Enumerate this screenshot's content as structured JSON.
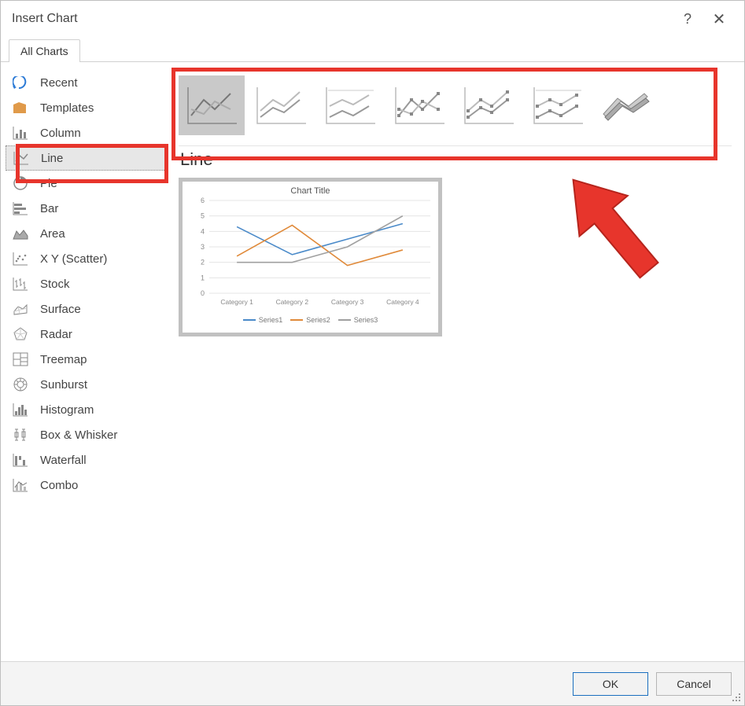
{
  "dialog": {
    "title": "Insert Chart",
    "help_glyph": "?",
    "close_glyph": "✕"
  },
  "tabs": {
    "all_charts": "All Charts"
  },
  "categories": [
    {
      "id": "recent",
      "label": "Recent",
      "icon": "recent"
    },
    {
      "id": "templates",
      "label": "Templates",
      "icon": "templates"
    },
    {
      "id": "column",
      "label": "Column",
      "icon": "column"
    },
    {
      "id": "line",
      "label": "Line",
      "icon": "line",
      "selected": true
    },
    {
      "id": "pie",
      "label": "Pie",
      "icon": "pie"
    },
    {
      "id": "bar",
      "label": "Bar",
      "icon": "bar"
    },
    {
      "id": "area",
      "label": "Area",
      "icon": "area"
    },
    {
      "id": "scatter",
      "label": "X Y (Scatter)",
      "icon": "scatter"
    },
    {
      "id": "stock",
      "label": "Stock",
      "icon": "stock"
    },
    {
      "id": "surface",
      "label": "Surface",
      "icon": "surface"
    },
    {
      "id": "radar",
      "label": "Radar",
      "icon": "radar"
    },
    {
      "id": "treemap",
      "label": "Treemap",
      "icon": "treemap"
    },
    {
      "id": "sunburst",
      "label": "Sunburst",
      "icon": "sunburst"
    },
    {
      "id": "histogram",
      "label": "Histogram",
      "icon": "histogram"
    },
    {
      "id": "boxwhisker",
      "label": "Box & Whisker",
      "icon": "boxwhisker"
    },
    {
      "id": "waterfall",
      "label": "Waterfall",
      "icon": "waterfall"
    },
    {
      "id": "combo",
      "label": "Combo",
      "icon": "combo"
    }
  ],
  "subtypes": [
    {
      "id": "line",
      "selected": true
    },
    {
      "id": "stacked-line"
    },
    {
      "id": "100-stacked-line"
    },
    {
      "id": "line-markers"
    },
    {
      "id": "stacked-line-markers"
    },
    {
      "id": "100-stacked-line-markers"
    },
    {
      "id": "3d-line"
    }
  ],
  "panel": {
    "subtitle": "Line"
  },
  "preview": {
    "title": "Chart Title",
    "legend": [
      "Series1",
      "Series2",
      "Series3"
    ],
    "colors": {
      "series1": "#4a8ac9",
      "series2": "#e08a3a",
      "series3": "#a0a0a0"
    }
  },
  "buttons": {
    "ok": "OK",
    "cancel": "Cancel"
  },
  "chart_data": {
    "type": "line",
    "title": "Chart Title",
    "xlabel": "",
    "ylabel": "",
    "ylim": [
      0,
      6
    ],
    "categories": [
      "Category 1",
      "Category 2",
      "Category 3",
      "Category 4"
    ],
    "series": [
      {
        "name": "Series1",
        "values": [
          4.3,
          2.5,
          3.5,
          4.5
        ]
      },
      {
        "name": "Series2",
        "values": [
          2.4,
          4.4,
          1.8,
          2.8
        ]
      },
      {
        "name": "Series3",
        "values": [
          2.0,
          2.0,
          3.0,
          5.0
        ]
      }
    ],
    "grid": true,
    "legend_position": "bottom"
  }
}
